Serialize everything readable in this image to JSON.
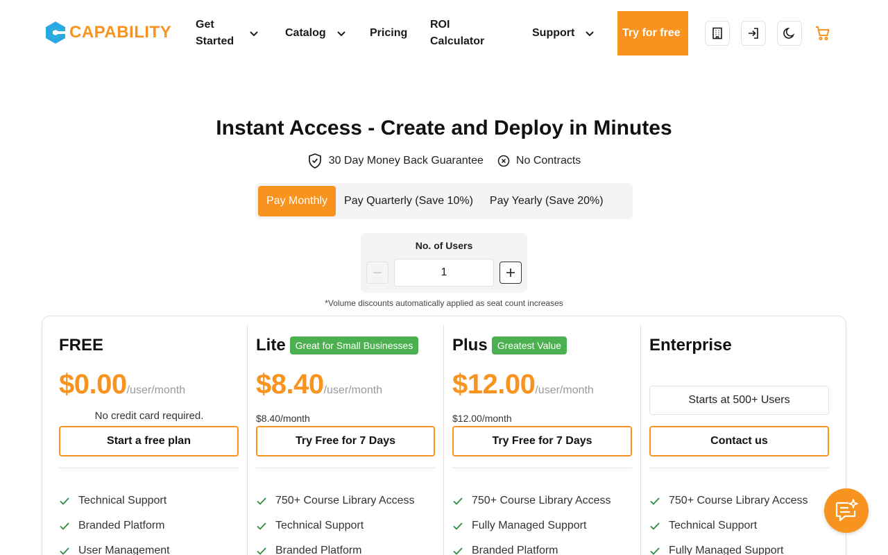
{
  "header": {
    "logo_text": "CAPABILITY",
    "nav": {
      "get_started": "Get Started",
      "catalog": "Catalog",
      "pricing": "Pricing",
      "roi_calculator": "ROI Calculator",
      "support": "Support"
    },
    "try_free": "Try for free",
    "icons": [
      "building-icon",
      "sign-in-icon",
      "moon-icon",
      "cart-icon"
    ]
  },
  "hero": {
    "title": "Instant Access - Create and Deploy in Minutes",
    "guarantees": [
      "30 Day Money Back Guarantee",
      "No Contracts"
    ]
  },
  "billing": {
    "options": [
      "Pay Monthly",
      "Pay Quarterly (Save 10%)",
      "Pay Yearly (Save 20%)"
    ],
    "selected": "Pay Monthly"
  },
  "users": {
    "label": "No. of Users",
    "value": "1",
    "note": "*Volume discounts automatically applied as seat count increases"
  },
  "plans": [
    {
      "name": "FREE",
      "badge": "",
      "price": "$0.00",
      "unit": "/user/month",
      "sub": "No credit card required.",
      "cta": "Start a free plan",
      "features": [
        "Technical Support",
        "Branded Platform",
        "User Management"
      ]
    },
    {
      "name": "Lite",
      "badge": "Great for Small Businesses",
      "price": "$8.40",
      "unit": "/user/month",
      "sub": "$8.40/month",
      "cta": "Try Free for 7 Days",
      "features": [
        "750+ Course Library Access",
        "Technical Support",
        "Branded Platform"
      ]
    },
    {
      "name": "Plus",
      "badge": "Greatest Value",
      "price": "$12.00",
      "unit": "/user/month",
      "sub": "$12.00/month",
      "cta": "Try Free for 7 Days",
      "features": [
        "750+ Course Library Access",
        "Fully Managed Support",
        "Branded Platform"
      ]
    },
    {
      "name": "Enterprise",
      "badge": "",
      "starts_at": "Starts at 500+ Users",
      "cta": "Contact us",
      "features": [
        "750+ Course Library Access",
        "Technical Support",
        "Fully Managed Support"
      ]
    }
  ],
  "colors": {
    "accent": "#f7931e",
    "badge": "#4caf50",
    "logo_icon": "#2aa9e0"
  }
}
